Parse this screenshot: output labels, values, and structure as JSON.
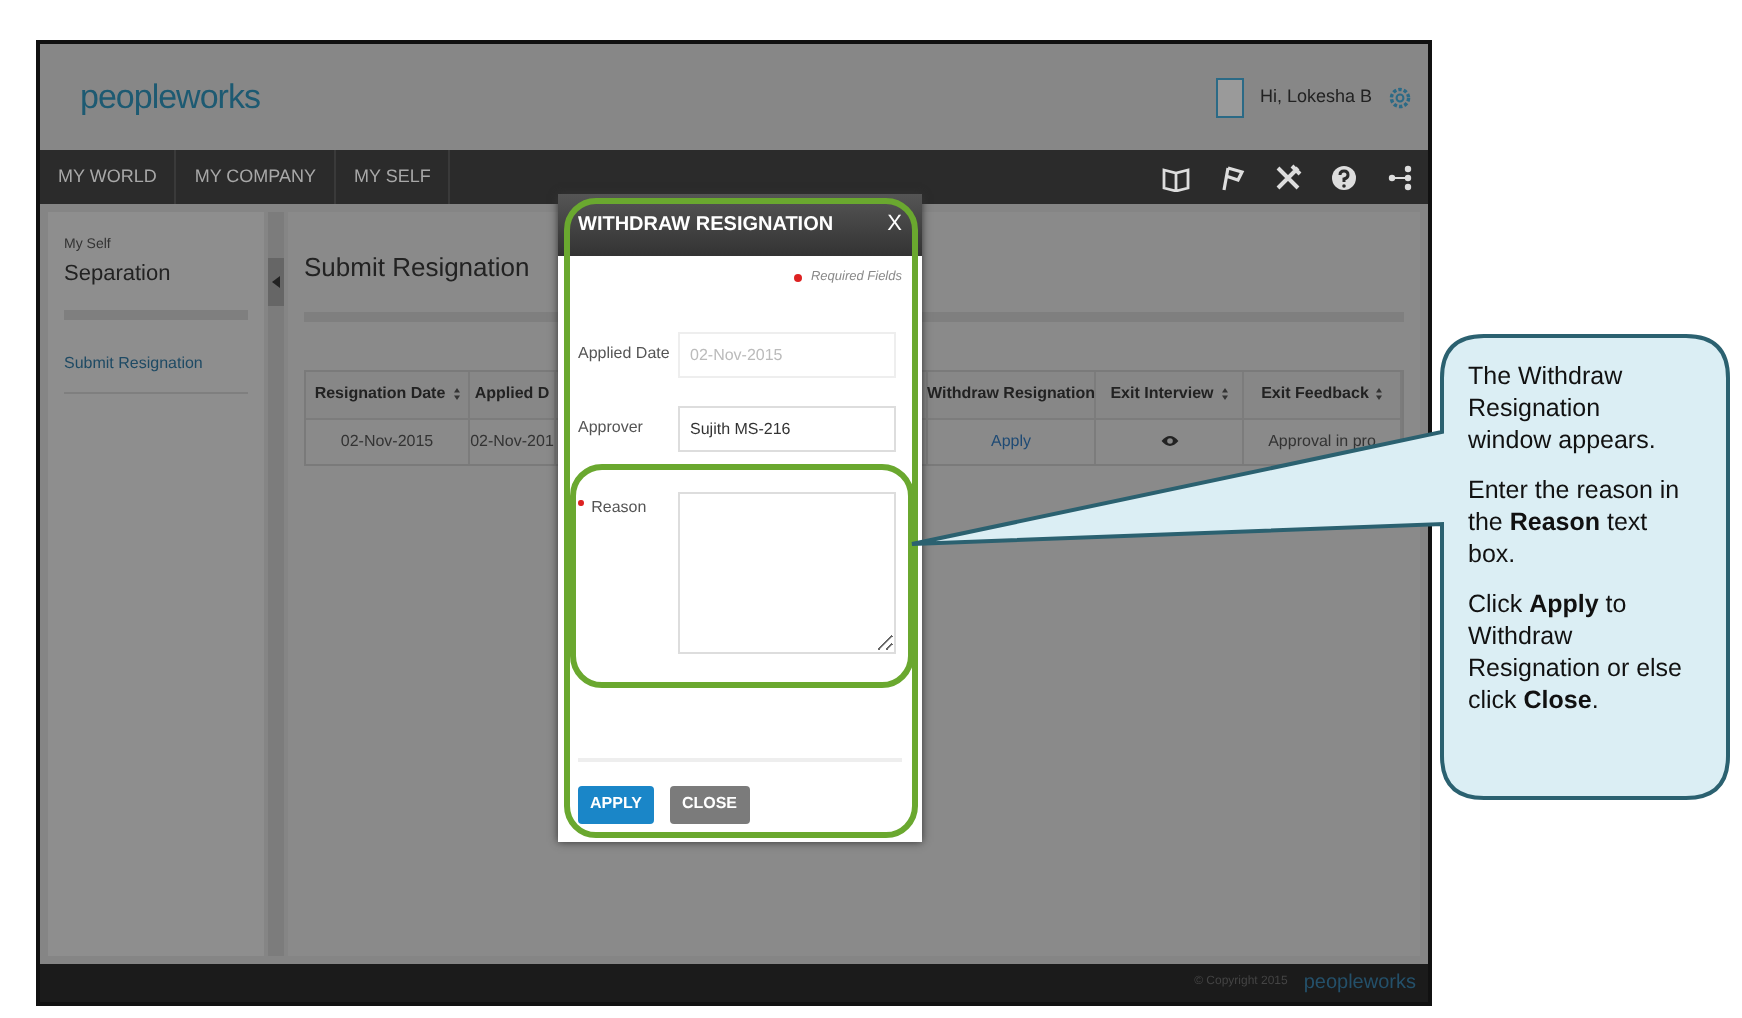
{
  "header": {
    "logo": "peopleworks",
    "greeting": "Hi, Lokesha B"
  },
  "nav": [
    "MY WORLD",
    "MY COMPANY",
    "MY SELF"
  ],
  "sidebar": {
    "breadcrumb": "My Self",
    "title": "Separation",
    "items": [
      "Submit Resignation"
    ]
  },
  "page_title": "Submit Resignation",
  "table": {
    "columns": [
      {
        "label": "Resignation Date",
        "sortable": true
      },
      {
        "label": "Applied D",
        "sortable": false
      },
      {
        "label": "Withdraw Resignation",
        "sortable": false
      },
      {
        "label": "Exit Interview",
        "sortable": true
      },
      {
        "label": "Exit Feedback",
        "sortable": true
      }
    ],
    "rows": [
      {
        "cells": [
          {
            "kind": "text",
            "text": "02-Nov-2015"
          },
          {
            "kind": "text",
            "text": "02-Nov-201"
          },
          {
            "kind": "link",
            "text": "Apply"
          },
          {
            "kind": "icon"
          },
          {
            "kind": "text",
            "text": "Approval in pro"
          }
        ]
      }
    ]
  },
  "modal": {
    "title": "WITHDRAW RESIGNATION",
    "close": "X",
    "required_note": "Required Fields",
    "fields": [
      {
        "label": "Applied Date",
        "kind": "input",
        "value": "02-Nov-2015",
        "disabled": true,
        "required": false
      },
      {
        "label": "Approver",
        "kind": "input",
        "value": "Sujith MS-216",
        "disabled": false,
        "required": false
      },
      {
        "label": "Reason",
        "kind": "textarea",
        "disabled": false,
        "required": true
      }
    ],
    "buttons": [
      {
        "label": "APPLY",
        "kind": "primary"
      },
      {
        "label": "CLOSE",
        "kind": "secondary"
      }
    ]
  },
  "footer": {
    "copyright": "© Copyright 2015",
    "logo": "peopleworks"
  },
  "callout": {
    "paragraphs": [
      "The Withdraw Resignation window appears.",
      "Enter the reason in the **Reason** text box.",
      "Click **Apply** to Withdraw Resignation or else click **Close**."
    ]
  }
}
